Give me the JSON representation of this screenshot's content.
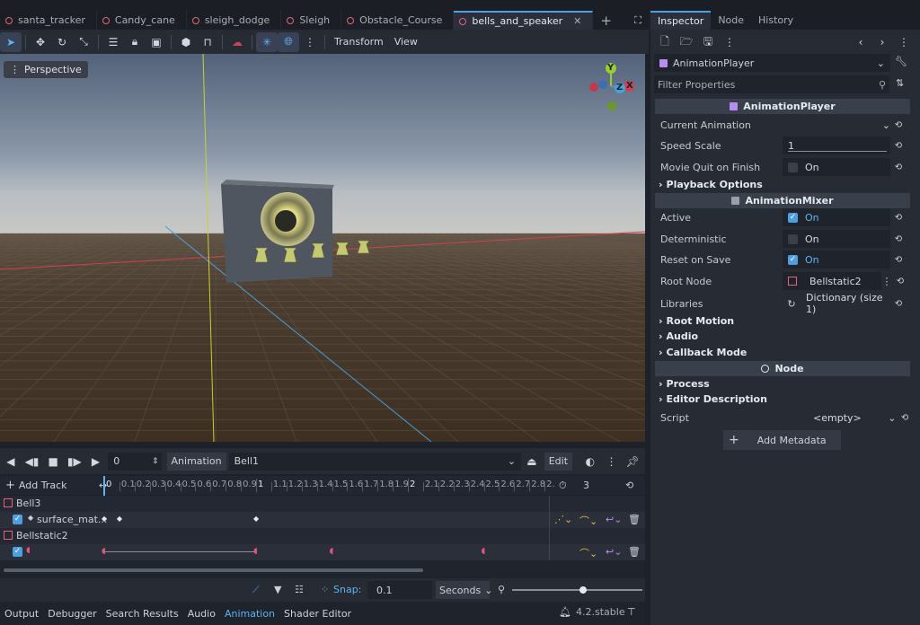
{
  "scene_tabs": [
    "santa_tracker",
    "Candy_cane",
    "sleigh_dodge",
    "Sleigh",
    "Obstacle_Course",
    "bells_and_speaker"
  ],
  "active_tab": "bells_and_speaker",
  "toolbar": {
    "transform_label": "Transform",
    "view_label": "View"
  },
  "viewport": {
    "mode_label": "Perspective",
    "gizmo": {
      "y": "Y",
      "x": "X",
      "z": "Z"
    }
  },
  "animation": {
    "time_value": "0",
    "animation_label": "Animation",
    "current_animation": "Bell1",
    "edit_label": "Edit",
    "add_track_label": "Add Track",
    "length_value": "3",
    "ticks": [
      "0",
      "0.1",
      "0.2",
      "0.3",
      "0.4",
      "0.5",
      "0.6",
      "0.7",
      "0.8",
      "0.9",
      "1",
      "1.1",
      "1.2",
      "1.3",
      "1.4",
      "1.5",
      "1.6",
      "1.7",
      "1.8",
      "1.9",
      "2",
      "2.1",
      "2.2",
      "2.3",
      "2.4",
      "2.5",
      "2.6",
      "2.7",
      "2.8",
      "2."
    ],
    "tracks": [
      {
        "node": "Bell3",
        "property": "surface_mat...",
        "keys": [
          0,
          0.1,
          1.0
        ]
      },
      {
        "node": "Bellstatic2",
        "property": "",
        "keys": [
          0,
          1.0,
          1.5,
          2.5
        ]
      }
    ],
    "snap_label": "Snap:",
    "snap_value": "0.1",
    "unit_value": "Seconds"
  },
  "bottom_tabs": [
    "Output",
    "Debugger",
    "Search Results",
    "Audio",
    "Animation",
    "Shader Editor"
  ],
  "active_bottom_tab": "Animation",
  "version": "4.2.stable",
  "inspector": {
    "tabs": [
      "Inspector",
      "Node",
      "History"
    ],
    "object_name": "AnimationPlayer",
    "filter_placeholder": "Filter Properties",
    "section_animplayer": "AnimationPlayer",
    "current_animation_label": "Current Animation",
    "speed_scale_label": "Speed Scale",
    "speed_scale_value": "1",
    "movie_quit_label": "Movie Quit on Finish",
    "movie_quit_value": "On",
    "playback_options_label": "Playback Options",
    "section_animmixer": "AnimationMixer",
    "active_label": "Active",
    "active_value": "On",
    "deterministic_label": "Deterministic",
    "deterministic_value": "On",
    "reset_on_save_label": "Reset on Save",
    "reset_on_save_value": "On",
    "root_node_label": "Root Node",
    "root_node_value": "Bellstatic2",
    "libraries_label": "Libraries",
    "libraries_value": "Dictionary (size 1)",
    "root_motion_label": "Root Motion",
    "audio_label": "Audio",
    "callback_mode_label": "Callback Mode",
    "section_node": "Node",
    "process_label": "Process",
    "editor_description_label": "Editor Description",
    "script_label": "Script",
    "script_value": "<empty>",
    "add_metadata_label": "Add Metadata"
  },
  "colors": {
    "accent": "#4f9fe0",
    "scene_dot": "#e0657a",
    "key_pink": "#e0557a",
    "axis_red": "#d04050",
    "axis_green": "#9acd32",
    "axis_blue": "#4a9fd8"
  }
}
